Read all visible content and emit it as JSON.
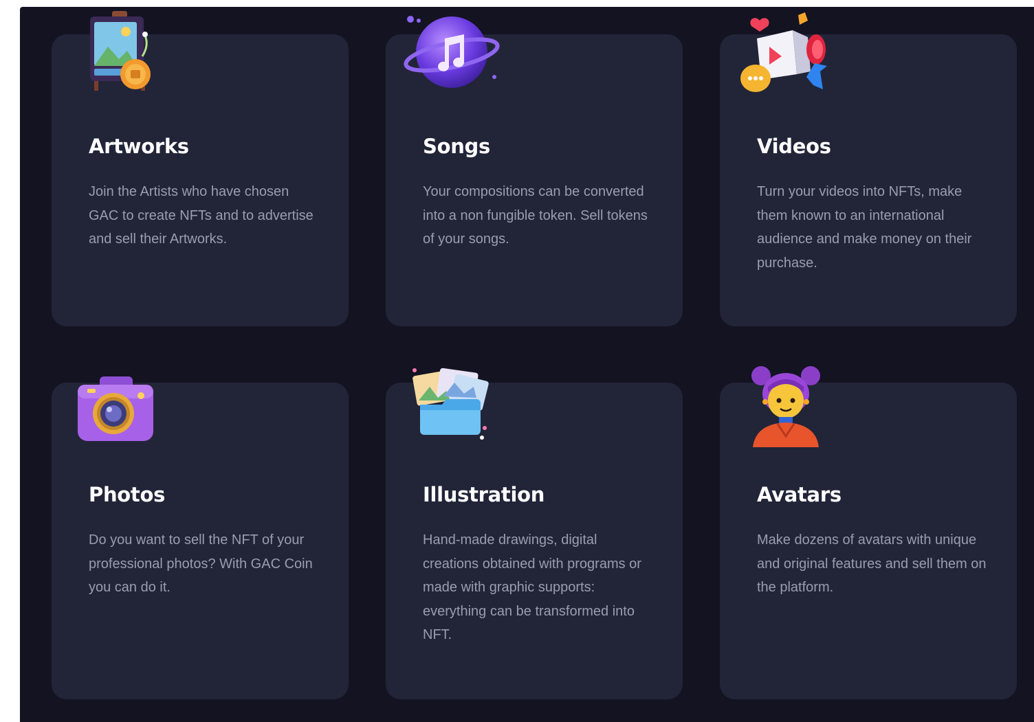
{
  "cards": [
    {
      "title": "Artworks",
      "description": "Join the Artists who have chosen GAC to create NFTs and to advertise and sell their Artworks.",
      "icon": "easel-artwork-icon"
    },
    {
      "title": "Songs",
      "description": "Your compositions can be converted into a non fungible token. Sell tokens of your songs.",
      "icon": "music-note-planet-icon"
    },
    {
      "title": "Videos",
      "description": "Turn your videos into NFTs, make them known to an international audience and make money on their purchase.",
      "icon": "video-camera-icon"
    },
    {
      "title": "Photos",
      "description": "Do you want to sell the NFT of your professional photos? With GAC Coin you can do it.",
      "icon": "camera-icon"
    },
    {
      "title": "Illustration",
      "description": "Hand-made drawings, digital creations obtained with programs or made with graphic supports: everything can be transformed into NFT.",
      "icon": "picture-folder-icon"
    },
    {
      "title": "Avatars",
      "description": "Make dozens of avatars with unique and original features and sell them on the platform.",
      "icon": "avatar-character-icon"
    }
  ],
  "colors": {
    "background": "#141322",
    "card": "#222538",
    "title": "#ffffff",
    "text": "#9a9caf"
  }
}
